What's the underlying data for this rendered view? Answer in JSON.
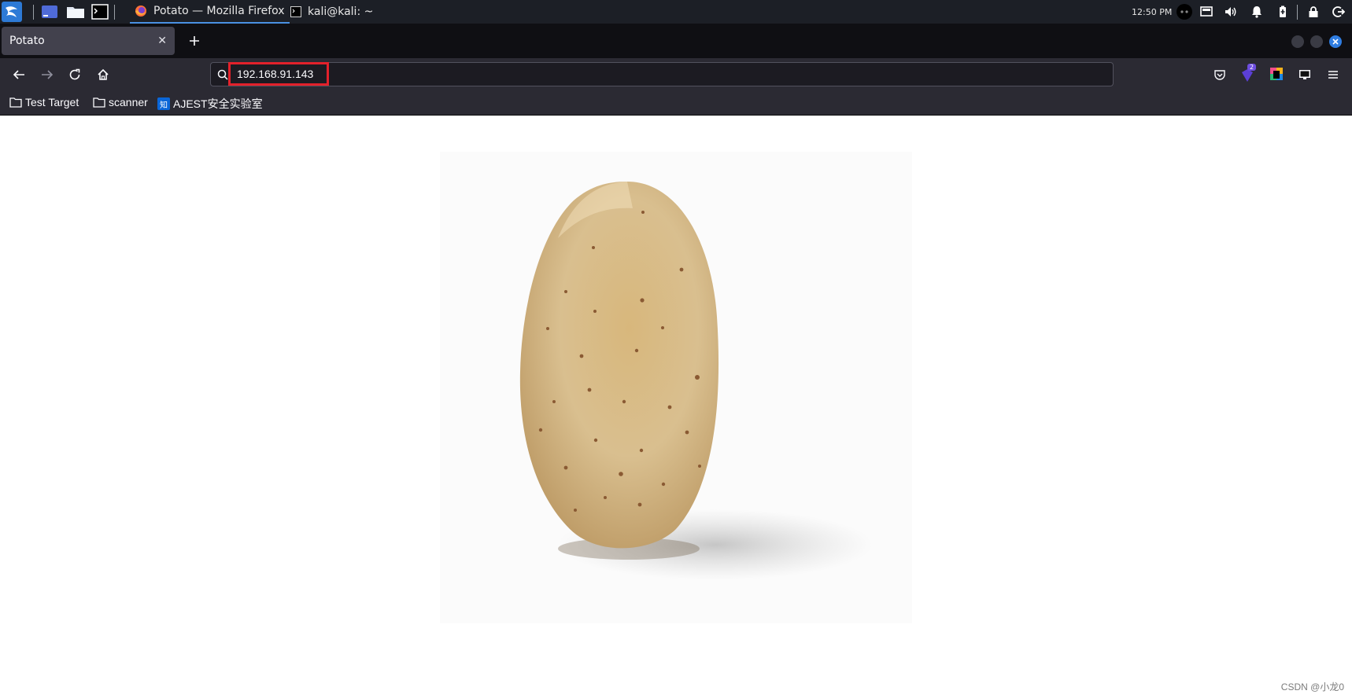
{
  "taskbar": {
    "tasks": [
      {
        "label": "Potato — Mozilla Firefox",
        "icon": "firefox-icon",
        "active": true
      },
      {
        "label": "kali@kali: ~",
        "icon": "terminal-icon",
        "active": false
      }
    ],
    "clock": "12:50 PM"
  },
  "browser": {
    "tab_title": "Potato",
    "url": "192.168.91.143",
    "bookmarks": [
      {
        "label": "Test Target",
        "icon": "folder-icon"
      },
      {
        "label": "scanner",
        "icon": "folder-icon"
      },
      {
        "label": "AJEST安全实验室",
        "icon": "zhihu-icon",
        "badge": "知"
      }
    ],
    "extension_badge": "2"
  },
  "page": {
    "image_subject": "potato",
    "watermark": "CSDN @小龙0"
  },
  "colors": {
    "highlight_box": "#e3212b",
    "panel_bg": "#1c1f26",
    "toolbar_bg": "#2b2a33"
  }
}
